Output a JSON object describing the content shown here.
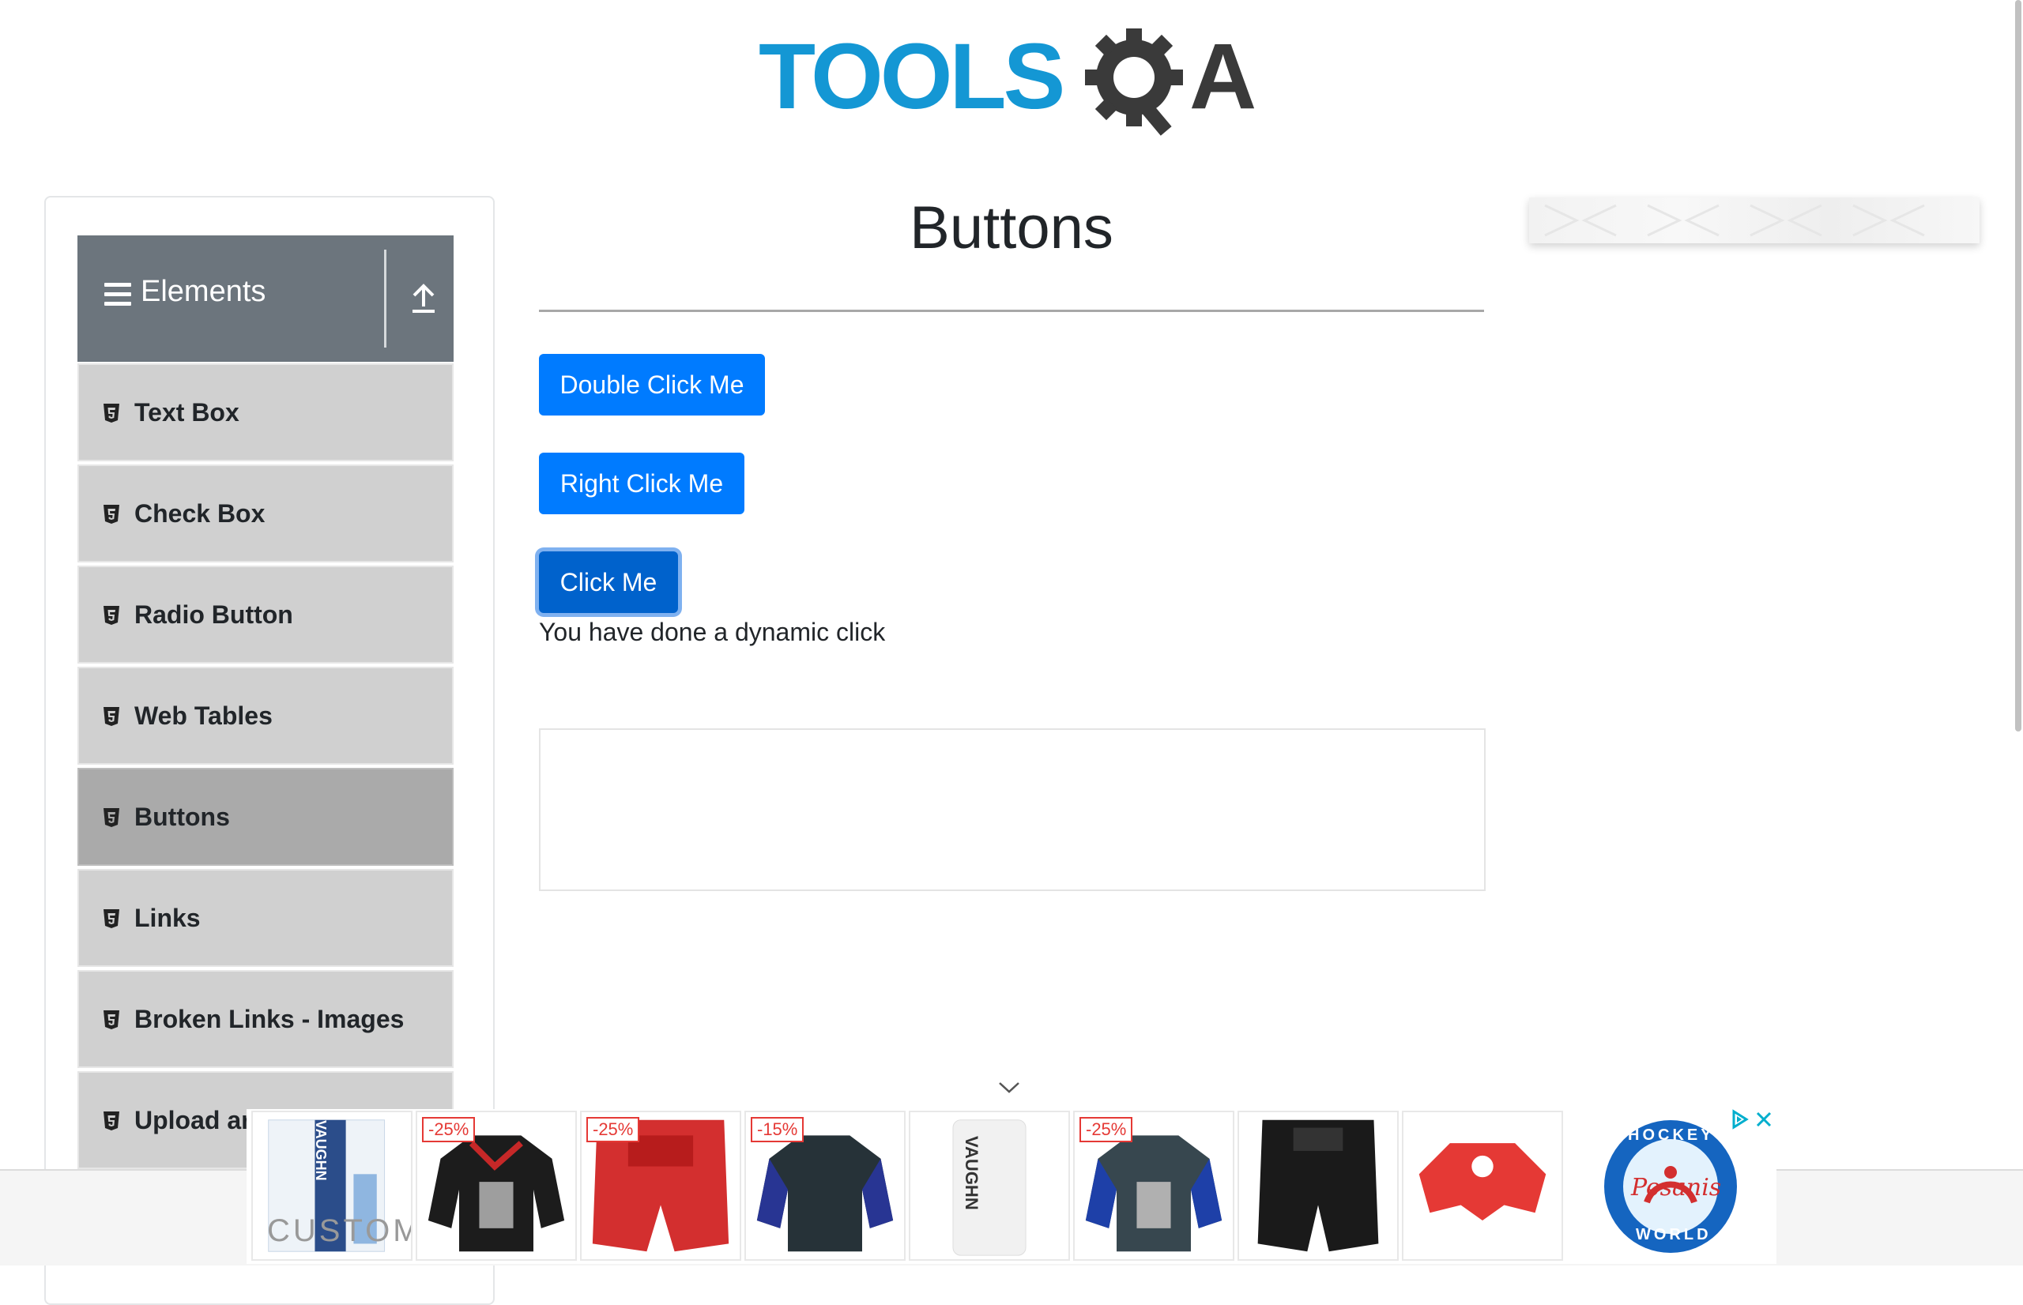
{
  "logo": {
    "word": "TOOLS",
    "letter_q_icon": "gear-magnifier-icon",
    "letter_a": "A",
    "colors": {
      "tools": "#1497d4",
      "qa": "#3a3a3a"
    }
  },
  "sidebar": {
    "group": {
      "title": "Elements",
      "menu_icon": "hamburger-icon",
      "toggle_icon": "collapse-arrow-icon"
    },
    "items": [
      {
        "label": "Text Box",
        "icon": "html5-icon",
        "active": false
      },
      {
        "label": "Check Box",
        "icon": "html5-icon",
        "active": false
      },
      {
        "label": "Radio Button",
        "icon": "html5-icon",
        "active": false
      },
      {
        "label": "Web Tables",
        "icon": "html5-icon",
        "active": false
      },
      {
        "label": "Buttons",
        "icon": "html5-icon",
        "active": true
      },
      {
        "label": "Links",
        "icon": "html5-icon",
        "active": false
      },
      {
        "label": "Broken Links - Images",
        "icon": "html5-icon",
        "active": false
      },
      {
        "label": "Upload ar",
        "icon": "html5-icon",
        "active": false
      }
    ]
  },
  "main": {
    "title": "Buttons",
    "buttons": {
      "double_click": "Double Click Me",
      "right_click": "Right Click Me",
      "click": "Click Me"
    },
    "message": "You have done a dynamic click"
  },
  "ad": {
    "badges": [
      "-25%",
      "-25%",
      "-15%",
      "",
      "-25%",
      "",
      ""
    ],
    "brand_text_top": "HOCKEY",
    "brand_text_script": "Pesanis",
    "brand_text_bottom": "WORLD",
    "tile1_text": "VAUGHN",
    "tile1_sub": "CUSTOM",
    "tile5_text": "VAUGHN",
    "accent": "#007bff"
  },
  "colors": {
    "primary_button": "#007bff",
    "active_button": "#0062cc",
    "sidebar_header": "#6c757d",
    "menu_item": "#d0d0d0",
    "menu_item_active": "#aaaaaa"
  }
}
